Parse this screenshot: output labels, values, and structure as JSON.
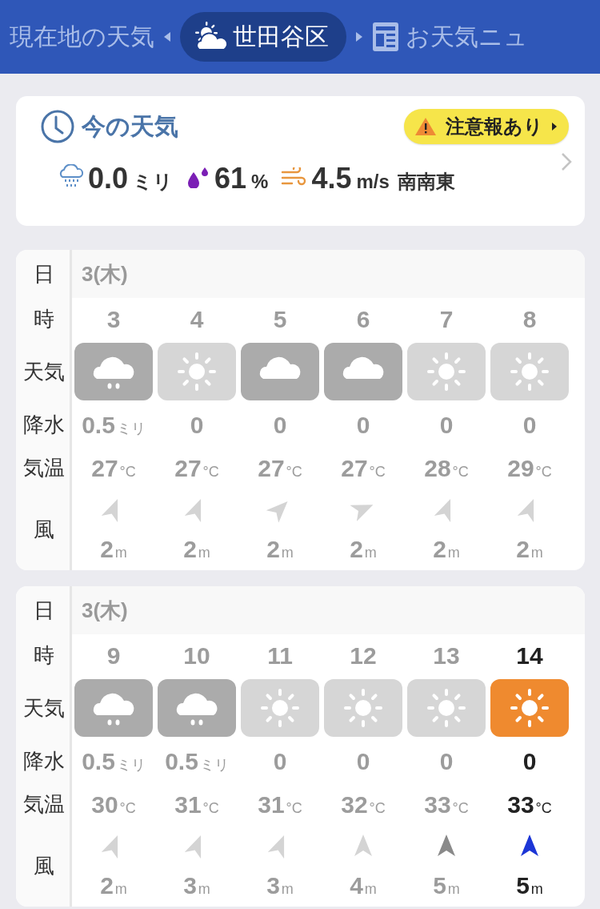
{
  "header": {
    "tabs": [
      {
        "label": "現在地の天気",
        "kind": "plain",
        "selected": false
      },
      {
        "label": "世田谷区",
        "kind": "place",
        "selected": true
      },
      {
        "label": "お天気ニュ",
        "kind": "news",
        "selected": false
      }
    ]
  },
  "now": {
    "title": "今の天気",
    "alert": "注意報あり",
    "precip": {
      "value": "0.0",
      "unit": "ミリ"
    },
    "humidity": {
      "value": "61",
      "unit": "%"
    },
    "wind": {
      "value": "4.5",
      "unit": "m/s",
      "direction": "南南東"
    }
  },
  "tables": [
    {
      "labels": {
        "date": "日",
        "hour": "時",
        "weather": "天気",
        "precip": "降水",
        "temp": "気温",
        "wind": "風"
      },
      "date": "3(木)",
      "hours": [
        {
          "hour": "3",
          "kind": "rain",
          "precip": "0.5",
          "precip_unit": "ミリ",
          "temp": "27",
          "temp_unit": "°C",
          "wind": {
            "kind": "nne",
            "speed": "2",
            "unit": "m",
            "strong": false
          },
          "selected": false
        },
        {
          "hour": "4",
          "kind": "sunny",
          "precip": "0",
          "temp": "27",
          "temp_unit": "°C",
          "wind": {
            "kind": "nne",
            "speed": "2",
            "unit": "m",
            "strong": false
          },
          "selected": false
        },
        {
          "hour": "5",
          "kind": "cloudy",
          "precip": "0",
          "temp": "27",
          "temp_unit": "°C",
          "wind": {
            "kind": "ne",
            "speed": "2",
            "unit": "m",
            "strong": false
          },
          "selected": false
        },
        {
          "hour": "6",
          "kind": "cloudy",
          "precip": "0",
          "temp": "27",
          "temp_unit": "°C",
          "wind": {
            "kind": "ene",
            "speed": "2",
            "unit": "m",
            "strong": false
          },
          "selected": false
        },
        {
          "hour": "7",
          "kind": "sunny",
          "precip": "0",
          "temp": "28",
          "temp_unit": "°C",
          "wind": {
            "kind": "nne",
            "speed": "2",
            "unit": "m",
            "strong": false
          },
          "selected": false
        },
        {
          "hour": "8",
          "kind": "sunny",
          "precip": "0",
          "temp": "29",
          "temp_unit": "°C",
          "wind": {
            "kind": "nne",
            "speed": "2",
            "unit": "m",
            "strong": false
          },
          "selected": false
        }
      ]
    },
    {
      "labels": {
        "date": "日",
        "hour": "時",
        "weather": "天気",
        "precip": "降水",
        "temp": "気温",
        "wind": "風"
      },
      "date": "3(木)",
      "hours": [
        {
          "hour": "9",
          "kind": "rain",
          "precip": "0.5",
          "precip_unit": "ミリ",
          "temp": "30",
          "temp_unit": "°C",
          "wind": {
            "kind": "nne",
            "speed": "2",
            "unit": "m",
            "strong": false
          },
          "selected": false
        },
        {
          "hour": "10",
          "kind": "rain",
          "precip": "0.5",
          "precip_unit": "ミリ",
          "temp": "31",
          "temp_unit": "°C",
          "wind": {
            "kind": "nne",
            "speed": "3",
            "unit": "m",
            "strong": false
          },
          "selected": false
        },
        {
          "hour": "11",
          "kind": "sunny",
          "precip": "0",
          "temp": "31",
          "temp_unit": "°C",
          "wind": {
            "kind": "nne",
            "speed": "3",
            "unit": "m",
            "strong": false
          },
          "selected": false
        },
        {
          "hour": "12",
          "kind": "sunny",
          "precip": "0",
          "temp": "32",
          "temp_unit": "°C",
          "wind": {
            "kind": "n",
            "speed": "4",
            "unit": "m",
            "strong": false
          },
          "selected": false
        },
        {
          "hour": "13",
          "kind": "sunny",
          "precip": "0",
          "temp": "33",
          "temp_unit": "°C",
          "wind": {
            "kind": "n",
            "speed": "5",
            "unit": "m",
            "strong": true
          },
          "selected": false
        },
        {
          "hour": "14",
          "kind": "sunny",
          "precip": "0",
          "temp": "33",
          "temp_unit": "°C",
          "wind": {
            "kind": "n",
            "speed": "5",
            "unit": "m",
            "strong": true
          },
          "selected": true
        }
      ]
    }
  ]
}
